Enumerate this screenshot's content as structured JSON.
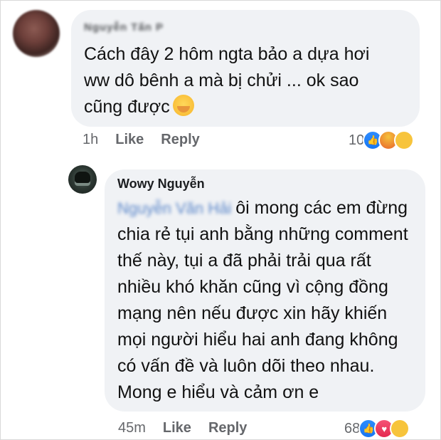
{
  "comment1": {
    "author": "Nguyễn Tấn P",
    "text_line1": "Cách đây 2 hôm ngta bảo a dựa hơi",
    "text_line2": "ww dô bênh a mà bị chửi ... ok sao",
    "text_line3": "cũng được",
    "time": "1h",
    "like_label": "Like",
    "reply_label": "Reply",
    "reaction_count": "10",
    "reactions": [
      "like-icon",
      "angry-icon",
      "haha-icon"
    ]
  },
  "comment2": {
    "author": "Wowy Nguyễn",
    "mention": "Nguyễn Văn Hải",
    "text": "ôi mong các em đừng chia rẻ tụi anh bằng những comment thế này, tụi a đã phải trải qua rất nhiều khó khăn cũng vì cộng đồng mạng nên nếu được xin hãy khiến mọi người hiểu hai anh đang không có vấn đề và luôn dõi theo nhau. Mong e hiểu và cảm ơn e",
    "time": "45m",
    "like_label": "Like",
    "reply_label": "Reply",
    "reaction_count": "68",
    "reactions": [
      "like-icon",
      "love-icon",
      "care-icon"
    ]
  },
  "colors": {
    "bubble": "#f0f2f5",
    "meta_text": "#65676b",
    "like_blue": "#1877f2"
  }
}
